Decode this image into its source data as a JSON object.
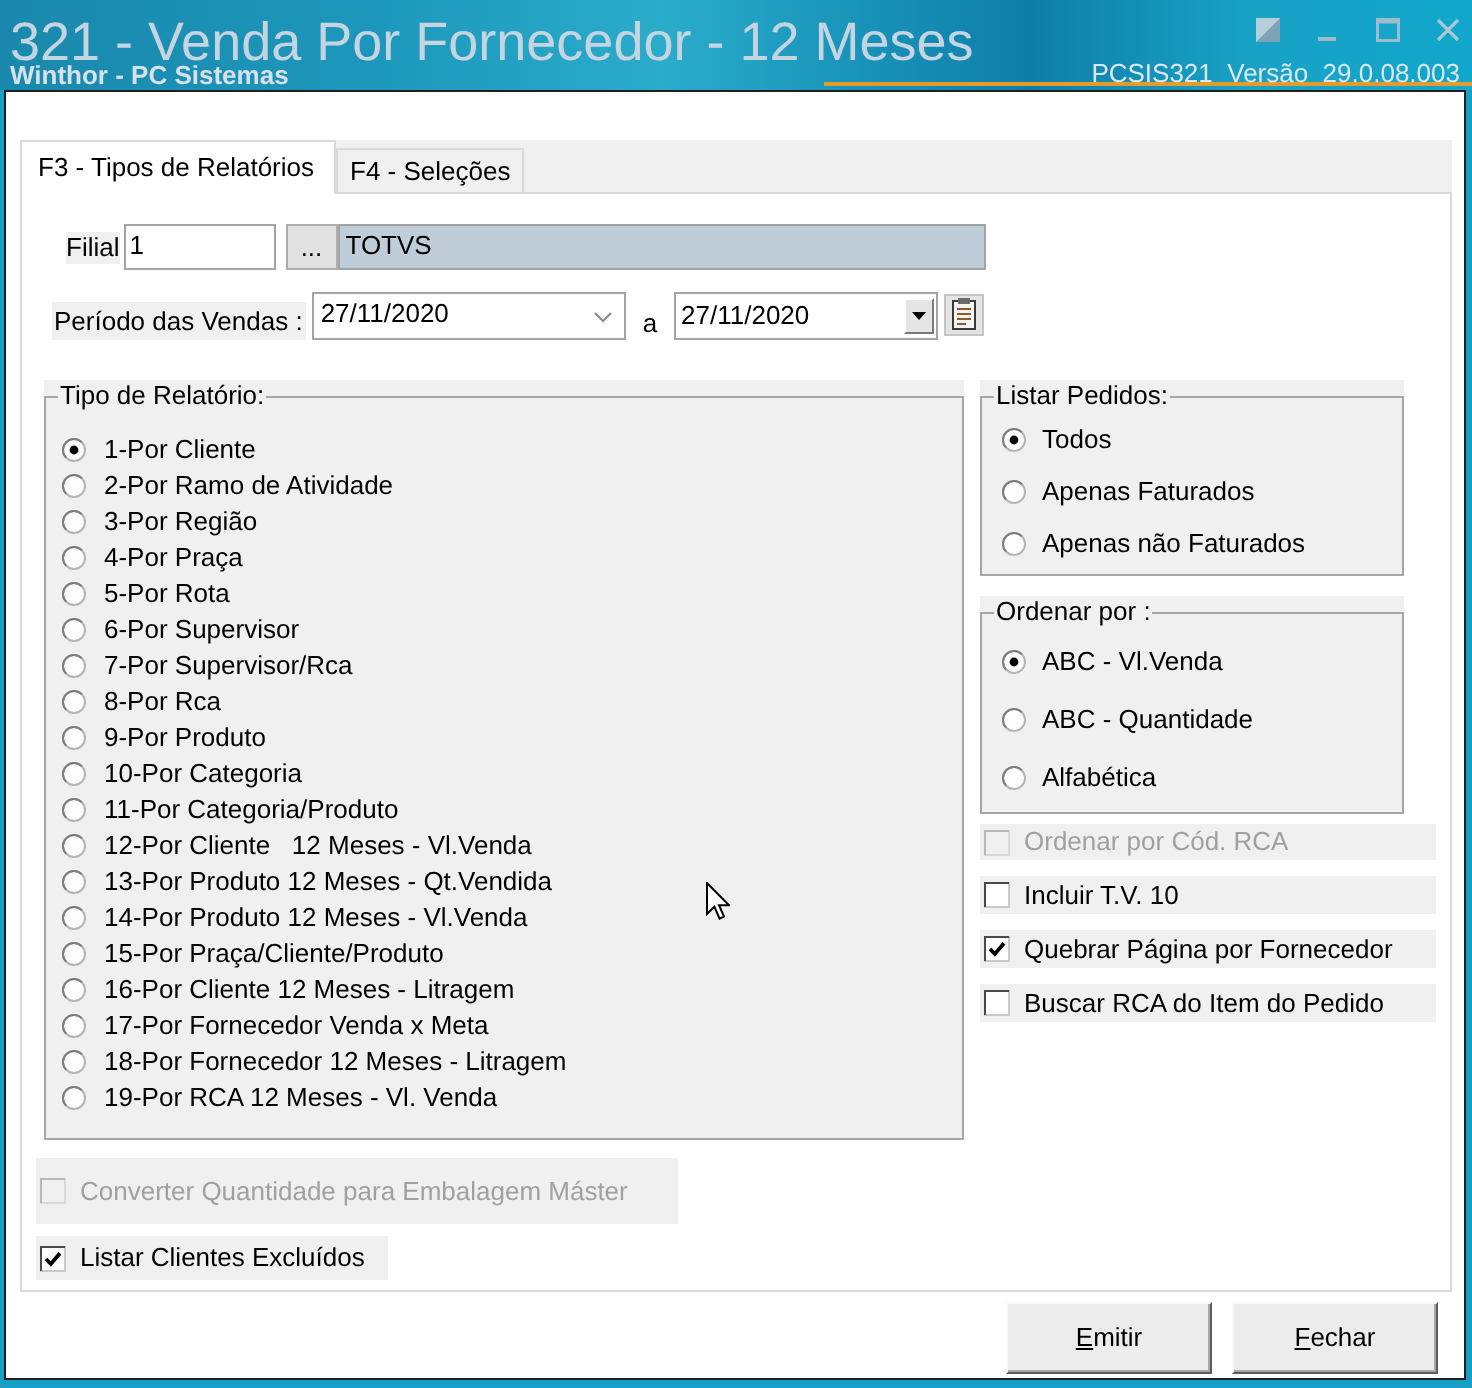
{
  "window": {
    "title": "321 - Venda Por Fornecedor - 12 Meses",
    "subtitle": "Winthor - PC Sistemas",
    "version": "PCSIS321  Versão  29.0.08.003"
  },
  "tabs": [
    {
      "label": "F3 - Tipos de Relatórios",
      "selected": true
    },
    {
      "label": "F4 - Seleções",
      "selected": false
    }
  ],
  "branch": {
    "label": "Filial",
    "code": "1",
    "lookup_button": "...",
    "name": "TOTVS"
  },
  "period": {
    "label": "Período das Vendas :",
    "from": "27/11/2020",
    "separator": "a",
    "to": "27/11/2020"
  },
  "report_type": {
    "title": "Tipo de Relatório:",
    "options": [
      {
        "label": "1-Por Cliente",
        "selected": true
      },
      {
        "label": "2-Por Ramo de Atividade",
        "selected": false
      },
      {
        "label": "3-Por Região",
        "selected": false
      },
      {
        "label": "4-Por Praça",
        "selected": false
      },
      {
        "label": "5-Por Rota",
        "selected": false
      },
      {
        "label": "6-Por Supervisor",
        "selected": false
      },
      {
        "label": "7-Por Supervisor/Rca",
        "selected": false
      },
      {
        "label": "8-Por Rca",
        "selected": false
      },
      {
        "label": "9-Por Produto",
        "selected": false
      },
      {
        "label": "10-Por Categoria",
        "selected": false
      },
      {
        "label": "11-Por Categoria/Produto",
        "selected": false
      },
      {
        "label": "12-Por Cliente   12 Meses - Vl.Venda",
        "selected": false
      },
      {
        "label": "13-Por Produto 12 Meses - Qt.Vendida",
        "selected": false
      },
      {
        "label": "14-Por Produto 12 Meses - Vl.Venda",
        "selected": false
      },
      {
        "label": "15-Por Praça/Cliente/Produto",
        "selected": false
      },
      {
        "label": "16-Por Cliente 12 Meses - Litragem",
        "selected": false
      },
      {
        "label": "17-Por Fornecedor Venda x Meta",
        "selected": false
      },
      {
        "label": "18-Por Fornecedor 12 Meses - Litragem",
        "selected": false
      },
      {
        "label": "19-Por RCA 12 Meses - Vl. Venda",
        "selected": false
      }
    ]
  },
  "list_orders": {
    "title": "Listar Pedidos:",
    "options": [
      {
        "label": "Todos",
        "selected": true
      },
      {
        "label": "Apenas Faturados",
        "selected": false
      },
      {
        "label": "Apenas não Faturados",
        "selected": false
      }
    ]
  },
  "order_by": {
    "title": "Ordenar por :",
    "options": [
      {
        "label": "ABC - Vl.Venda",
        "selected": true
      },
      {
        "label": "ABC - Quantidade",
        "selected": false
      },
      {
        "label": "Alfabética",
        "selected": false
      }
    ]
  },
  "side_options": [
    {
      "label": "Ordenar por Cód. RCA",
      "checked": false,
      "disabled": true
    },
    {
      "label": "Incluir T.V. 10",
      "checked": false,
      "disabled": false
    },
    {
      "label": "Quebrar Página por Fornecedor",
      "checked": true,
      "disabled": false
    },
    {
      "label": "Buscar RCA do Item do Pedido",
      "checked": false,
      "disabled": false
    }
  ],
  "bottom_options": [
    {
      "label": "Converter Quantidade para Embalagem Máster",
      "checked": false,
      "disabled": true
    },
    {
      "label": "Listar Clientes Excluídos",
      "checked": true,
      "disabled": false
    }
  ],
  "buttons": [
    {
      "label": "Emitir"
    },
    {
      "label": "Fechar"
    }
  ]
}
